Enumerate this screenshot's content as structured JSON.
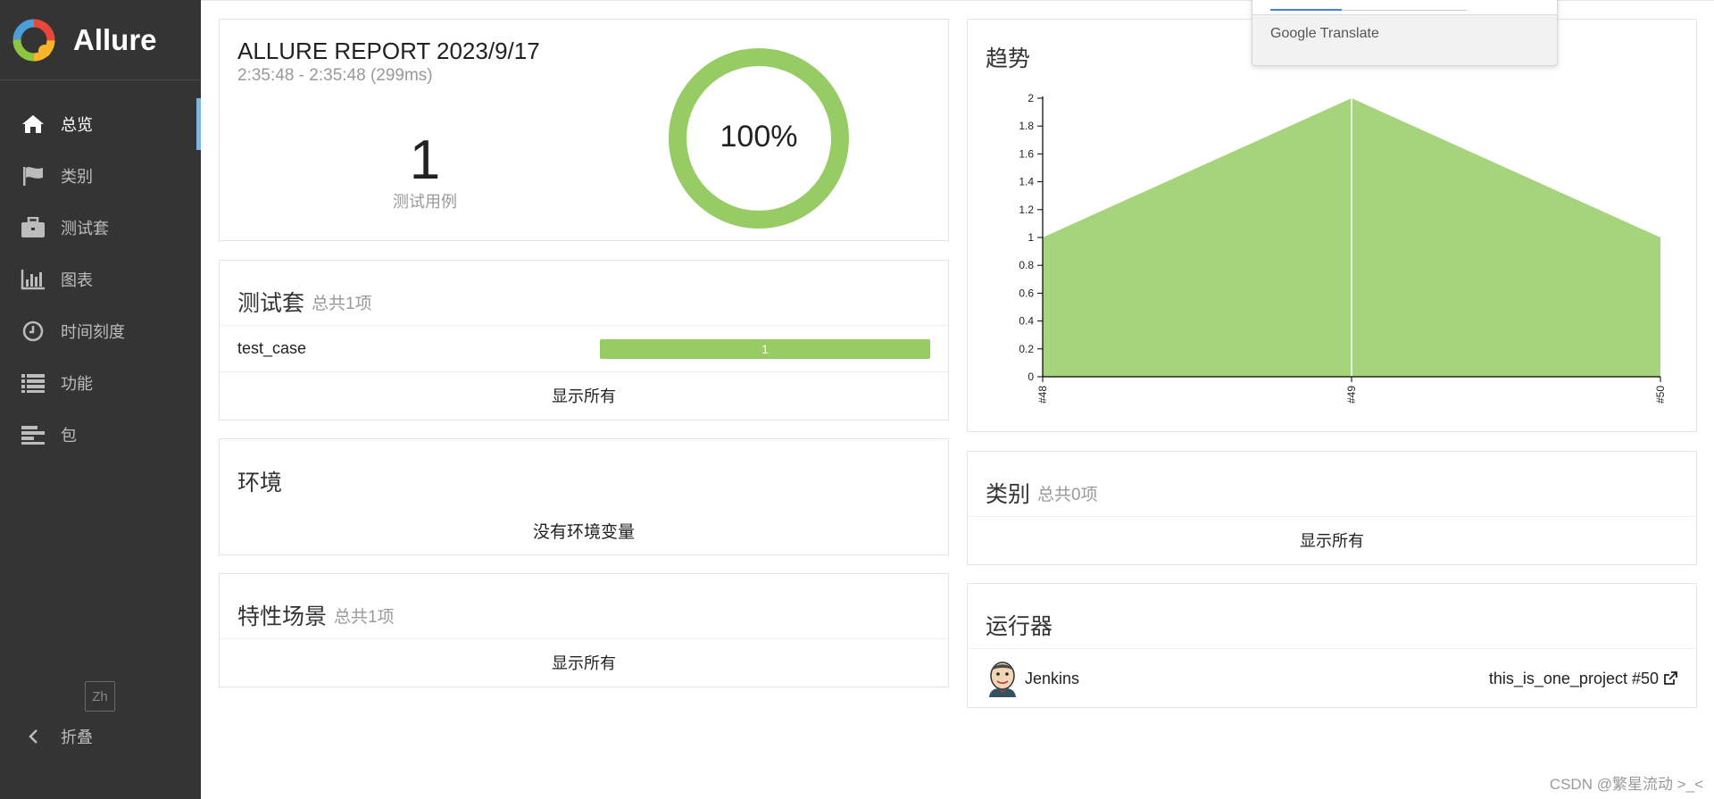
{
  "app": {
    "name": "Allure",
    "lang_button": "Zh",
    "collapse_label": "折叠"
  },
  "sidebar": {
    "items": [
      {
        "label": "总览",
        "icon": "home-icon",
        "active": true
      },
      {
        "label": "类别",
        "icon": "flag-icon",
        "active": false
      },
      {
        "label": "测试套",
        "icon": "briefcase-icon",
        "active": false
      },
      {
        "label": "图表",
        "icon": "bar-chart-icon",
        "active": false
      },
      {
        "label": "时间刻度",
        "icon": "clock-icon",
        "active": false
      },
      {
        "label": "功能",
        "icon": "list-icon",
        "active": false
      },
      {
        "label": "包",
        "icon": "align-left-icon",
        "active": false
      }
    ]
  },
  "summary": {
    "title": "ALLURE REPORT 2023/9/17",
    "time": "2:35:48 - 2:35:48 (299ms)",
    "count": "1",
    "count_label": "测试用例",
    "percent": "100%",
    "percent_value": 1.0
  },
  "suites": {
    "title": "测试套",
    "subtitle": "总共1项",
    "rows": [
      {
        "name": "test_case",
        "passed": "1"
      }
    ],
    "show_all": "显示所有"
  },
  "environment": {
    "title": "环境",
    "empty_text": "没有环境变量"
  },
  "features": {
    "title": "特性场景",
    "subtitle": "总共1项",
    "show_all": "显示所有"
  },
  "trend": {
    "title": "趋势"
  },
  "categories": {
    "title": "类别",
    "subtitle": "总共0项",
    "show_all": "显示所有"
  },
  "executors": {
    "title": "运行器",
    "name": "Jenkins",
    "link": "this_is_one_project #50"
  },
  "translate_popup": {
    "label": "Google Translate"
  },
  "watermark": "CSDN @繁星流动 >_<",
  "colors": {
    "passed": "#97cc64",
    "trend_fill": "#a6d47c",
    "sidebar_bg": "#343434",
    "active_marker": "#7fb4de"
  },
  "chart_data": {
    "type": "area",
    "x": [
      "#48",
      "#49",
      "#50"
    ],
    "series": [
      {
        "values": [
          1,
          2,
          1
        ]
      }
    ],
    "ylim": [
      0,
      2
    ],
    "yticks": [
      "0",
      "0.2",
      "0.4",
      "0.6",
      "0.8",
      "1",
      "1.2",
      "1.4",
      "1.6",
      "1.8",
      "2"
    ],
    "grid": false
  }
}
